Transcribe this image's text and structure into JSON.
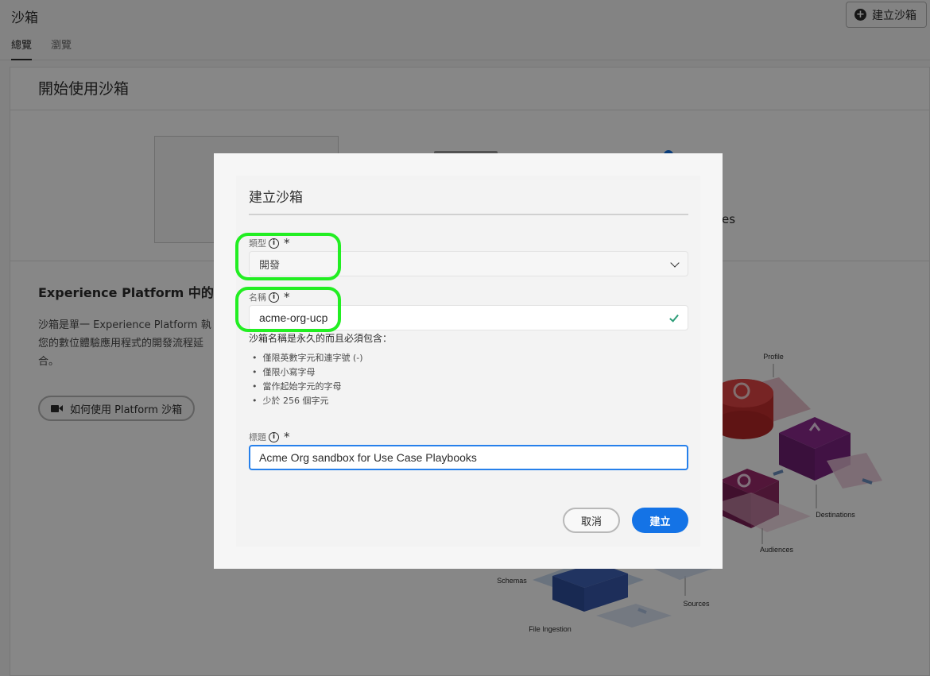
{
  "page": {
    "title": "沙箱",
    "create_button": "建立沙箱",
    "tabs": [
      {
        "label": "總覽",
        "active": true
      },
      {
        "label": "瀏覽",
        "active": false
      }
    ]
  },
  "card": {
    "title": "開始使用沙箱",
    "fragment_text": "es",
    "section_heading": "Experience Platform 中的",
    "section_text": "沙箱是單一 Experience Platform 執 您的數位體驗應用程式的開發流程延 合。",
    "video_button": "如何使用 Platform 沙箱"
  },
  "illustration": {
    "labels": {
      "profile": "Profile",
      "destinations": "Destinations",
      "audiences": "Audiences",
      "schemas": "Schemas",
      "sources": "Sources",
      "file_ingestion": "File Ingestion"
    }
  },
  "dialog": {
    "title": "建立沙箱",
    "type_field": {
      "label": "類型",
      "required_mark": "*",
      "value": "開發"
    },
    "name_field": {
      "label": "名稱",
      "required_mark": "*",
      "value": "acme-org-ucp"
    },
    "name_hint": {
      "heading": "沙箱名稱是永久的而且必須包含：",
      "items": [
        "僅限英數字元和連字號 (-)",
        "僅限小寫字母",
        "當作起始字元的字母",
        "少於 256 個字元"
      ]
    },
    "title_field": {
      "label": "標題",
      "required_mark": "*",
      "value": "Acme Org sandbox for Use Case Playbooks"
    },
    "cancel_label": "取消",
    "create_label": "建立"
  },
  "colors": {
    "accent": "#1473e6",
    "highlight": "#22ee22",
    "valid": "#2d9d78"
  }
}
